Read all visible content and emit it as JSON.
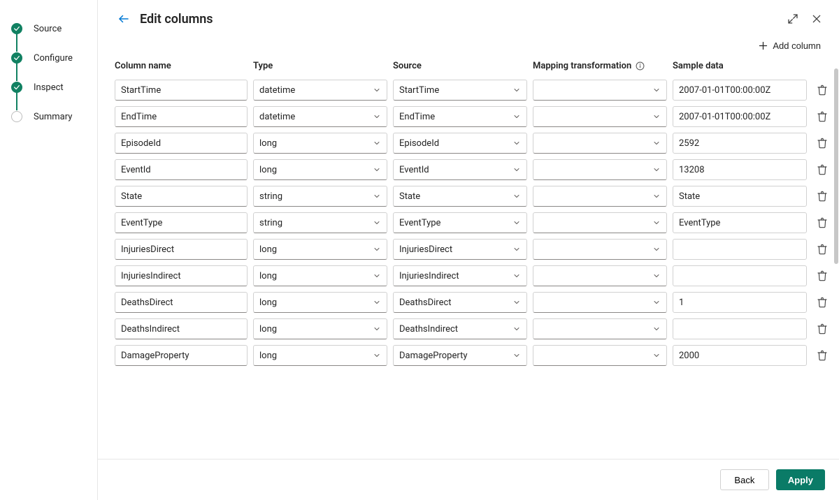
{
  "stepper": {
    "items": [
      {
        "label": "Source",
        "state": "done"
      },
      {
        "label": "Configure",
        "state": "done"
      },
      {
        "label": "Inspect",
        "state": "done"
      },
      {
        "label": "Summary",
        "state": "pending"
      }
    ]
  },
  "header": {
    "title": "Edit columns"
  },
  "toolbar": {
    "add_column_label": "Add column"
  },
  "columns_header": {
    "name": "Column name",
    "type": "Type",
    "source": "Source",
    "mapping": "Mapping transformation",
    "sample": "Sample data"
  },
  "rows": [
    {
      "name": "StartTime",
      "type": "datetime",
      "source": "StartTime",
      "mapping": "",
      "sample": "2007-01-01T00:00:00Z"
    },
    {
      "name": "EndTime",
      "type": "datetime",
      "source": "EndTime",
      "mapping": "",
      "sample": "2007-01-01T00:00:00Z"
    },
    {
      "name": "EpisodeId",
      "type": "long",
      "source": "EpisodeId",
      "mapping": "",
      "sample": "2592"
    },
    {
      "name": "EventId",
      "type": "long",
      "source": "EventId",
      "mapping": "",
      "sample": "13208"
    },
    {
      "name": "State",
      "type": "string",
      "source": "State",
      "mapping": "",
      "sample": "State"
    },
    {
      "name": "EventType",
      "type": "string",
      "source": "EventType",
      "mapping": "",
      "sample": "EventType"
    },
    {
      "name": "InjuriesDirect",
      "type": "long",
      "source": "InjuriesDirect",
      "mapping": "",
      "sample": ""
    },
    {
      "name": "InjuriesIndirect",
      "type": "long",
      "source": "InjuriesIndirect",
      "mapping": "",
      "sample": ""
    },
    {
      "name": "DeathsDirect",
      "type": "long",
      "source": "DeathsDirect",
      "mapping": "",
      "sample": "1"
    },
    {
      "name": "DeathsIndirect",
      "type": "long",
      "source": "DeathsIndirect",
      "mapping": "",
      "sample": ""
    },
    {
      "name": "DamageProperty",
      "type": "long",
      "source": "DamageProperty",
      "mapping": "",
      "sample": "2000"
    }
  ],
  "footer": {
    "back_label": "Back",
    "apply_label": "Apply"
  }
}
